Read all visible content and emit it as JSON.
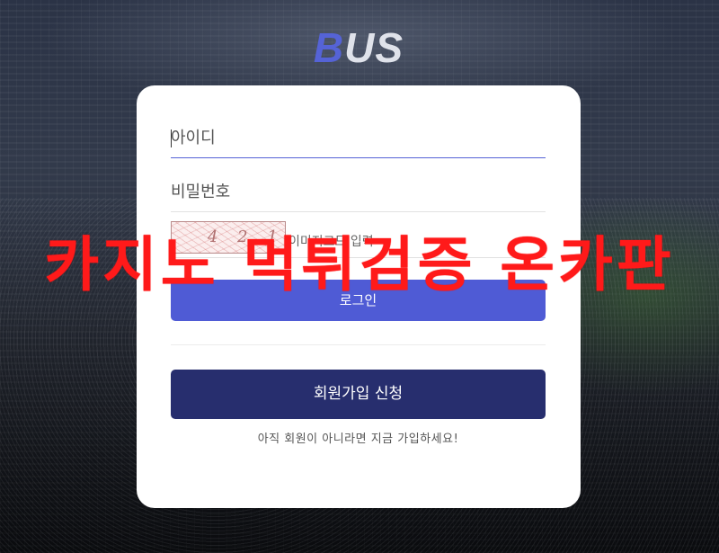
{
  "brand": {
    "logo_first": "B",
    "logo_rest": "US"
  },
  "login": {
    "id_placeholder": "아이디",
    "pw_placeholder": "비밀번호",
    "captcha_code": "4 2 1",
    "captcha_placeholder": "이미지코드 입력",
    "login_button": "로그인",
    "join_button": "회원가입 신청",
    "signup_note": "아직 회원이 아니라면 지금 가입하세요!"
  },
  "overlay_text": "카지노 먹튀검증 온카판",
  "colors": {
    "accent": "#4f5bd5",
    "join": "#272e6e",
    "overlay": "#ff1a1a",
    "logo_b": "#5563d6"
  }
}
